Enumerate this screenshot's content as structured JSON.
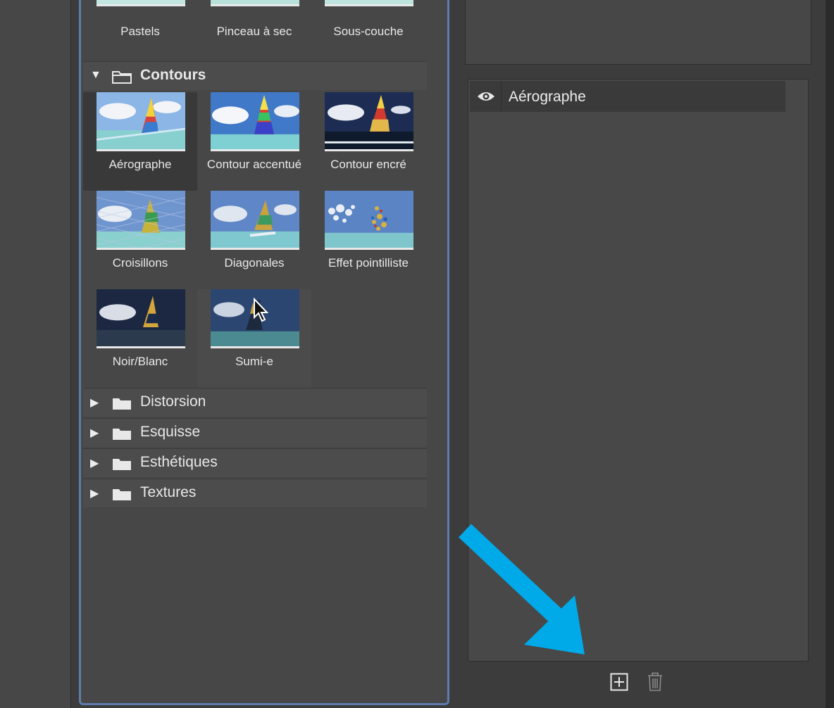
{
  "gallery": {
    "top_row": [
      {
        "label": "Pastels"
      },
      {
        "label": "Pinceau à sec"
      },
      {
        "label": "Sous-couche"
      }
    ],
    "open_category": {
      "label": "Contours",
      "filters": [
        {
          "label": "Aérographe",
          "selected": true
        },
        {
          "label": "Contour accentué"
        },
        {
          "label": "Contour encré"
        },
        {
          "label": "Croisillons"
        },
        {
          "label": "Diagonales"
        },
        {
          "label": "Effet pointilliste"
        },
        {
          "label": "Noir/Blanc"
        },
        {
          "label": "Sumi-e"
        }
      ]
    },
    "collapsed_categories": [
      {
        "label": "Distorsion"
      },
      {
        "label": "Esquisse"
      },
      {
        "label": "Esthétiques"
      },
      {
        "label": "Textures"
      }
    ]
  },
  "layers": {
    "items": [
      {
        "label": "Aérographe",
        "visible": true
      }
    ]
  },
  "colors": {
    "accent_border": "#5f7cae",
    "annotation_arrow": "#00a9e8"
  }
}
